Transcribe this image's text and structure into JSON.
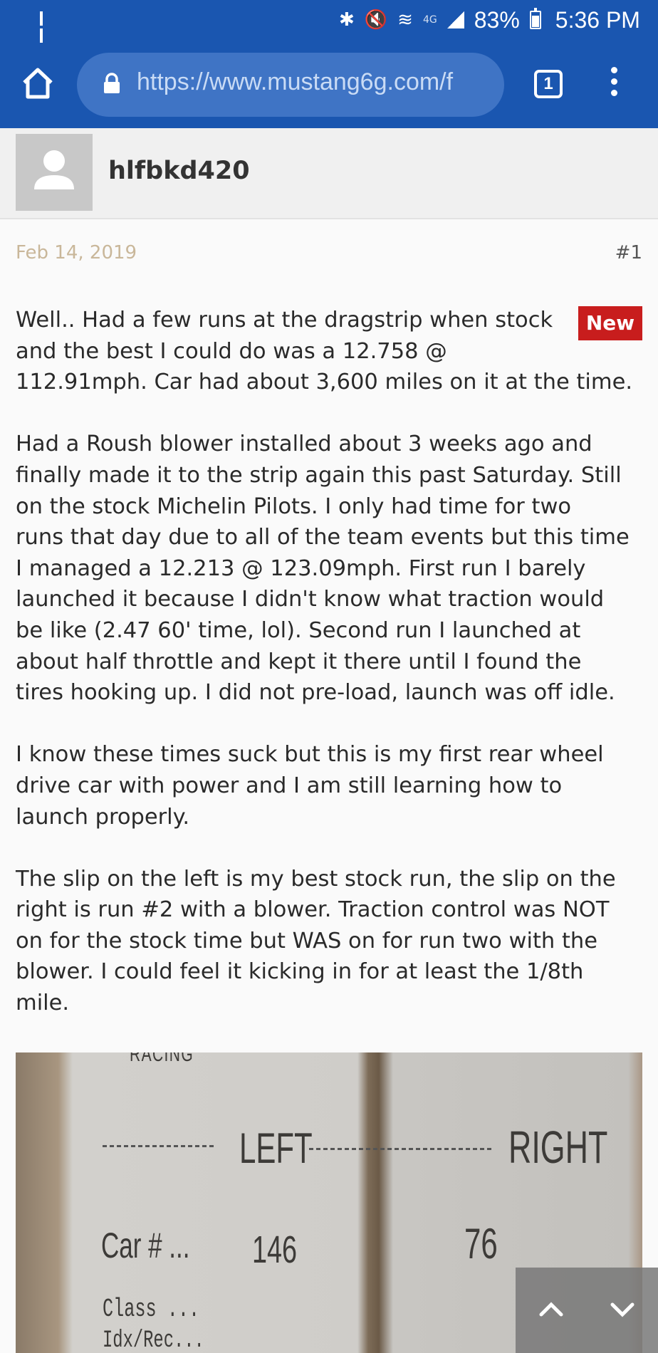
{
  "status_bar": {
    "battery": "83%",
    "time": "5:36 PM",
    "network": "4G"
  },
  "browser": {
    "url": "https://www.mustang6g.com/f",
    "tab_count": "1"
  },
  "post": {
    "username": "hlfbkd420",
    "date": "Feb 14, 2019",
    "number": "#1",
    "badge": "New",
    "paragraphs": [
      [
        "Well.. Had a few runs at the dragstrip when stock",
        "and the best I could do was a 12.758 @",
        "112.91mph. Car had about 3,600 miles on it at the time."
      ],
      [
        "Had a Roush blower installed about 3 weeks ago and",
        "finally made it to the strip again this past Saturday. Still",
        "on the stock Michelin Pilots. I only had time for two",
        "runs that day due to all of the team events but this time",
        "I managed a 12.213 @ 123.09mph. First run I barely",
        "launched it because I didn't know what traction would",
        "be like (2.47 60' time, lol). Second run I launched at",
        "about half throttle and kept it there until I found the",
        "tires hooking up. I did not pre-load, launch was off idle."
      ],
      [
        "I know these times suck but this is my first rear wheel",
        "drive car with power and I am still learning how to",
        "launch properly."
      ],
      [
        "The slip on the left is my best stock run, the slip on the",
        "right is run #2 with a blower. Traction control was NOT",
        "on for the stock time but WAS on for run two with the",
        "blower. I could feel it kicking in for at least the 1/8th",
        "mile."
      ]
    ]
  },
  "receipt": {
    "top_left": "RACING",
    "left_header": "LEFT",
    "right_header": "RIGHT",
    "car_label": "Car # ...",
    "left_car": "146",
    "right_car": "76",
    "class_label": "Class ...",
    "idx_label": "Idx/Rec..."
  },
  "colors": {
    "browser_bar": "#1a56b0",
    "url_pill": "#3f74c5",
    "badge": "#c81d1d",
    "date": "#c9b79a"
  }
}
